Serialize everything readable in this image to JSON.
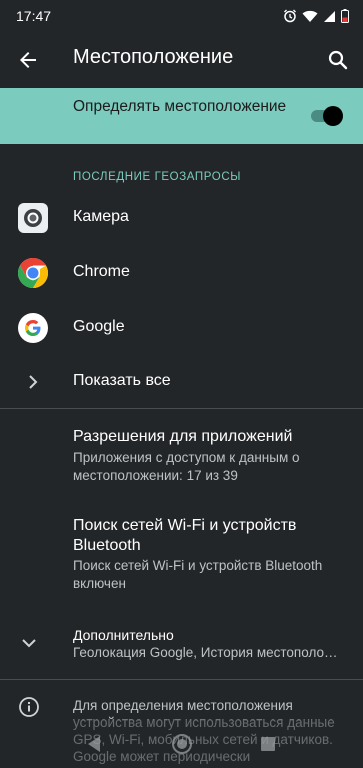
{
  "status_bar": {
    "time": "17:47"
  },
  "toolbar": {
    "title": "Местоположение"
  },
  "master_switch": {
    "label": "Определять местоположение",
    "state": "on"
  },
  "recent": {
    "header": "ПОСЛЕДНИЕ ГЕОЗАПРОСЫ",
    "items": [
      {
        "label": "Камера",
        "icon": "camera-app-icon"
      },
      {
        "label": "Chrome",
        "icon": "chrome-app-icon"
      },
      {
        "label": "Google",
        "icon": "google-app-icon"
      }
    ],
    "show_all": "Показать все"
  },
  "prefs": [
    {
      "title": "Разрешения для приложений",
      "summary": "Приложения с доступом к данным о местоположении: 17 из 39"
    },
    {
      "title": "Поиск сетей Wi-Fi и устройств Bluetooth",
      "summary": "Поиск сетей Wi-Fi и устройств Bluetooth включен"
    },
    {
      "title": "Дополнительно",
      "summary": "Геолокация Google, История местополо…"
    }
  ],
  "footer": {
    "text": "Для определения местоположения устройства могут использоваться данные GPS, Wi-Fi, мобильных сетей и датчиков. Google может периодически"
  },
  "colors": {
    "background": "#232629",
    "accent": "#7bcbbe",
    "text_secondary": "#bfc2c4"
  }
}
